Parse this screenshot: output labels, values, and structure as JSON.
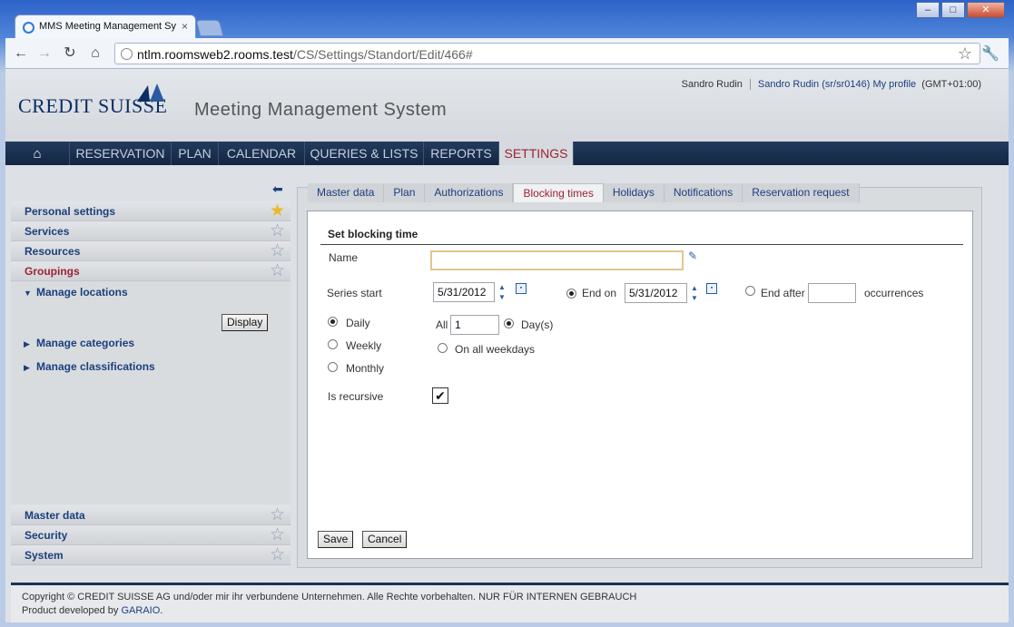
{
  "browser": {
    "tab_title": "MMS Meeting Management Sy",
    "tab_close": "×",
    "url_host": "ntlm.roomsweb2.rooms.test",
    "url_path": "/CS/Settings/Standort/Edit/466#",
    "window_buttons": {
      "minimize": "–",
      "maximize": "□",
      "close": "✕"
    },
    "nav": {
      "back": "←",
      "forward": "→",
      "reload": "↻",
      "home": "⌂"
    },
    "bookmark": "☆",
    "wrench": "🔧"
  },
  "header": {
    "logo_text": "CREDIT SUISSE",
    "app_title": "Meeting Management System",
    "user_name": "Sandro Rudin",
    "user_link": "Sandro Rudin (sr/sr0146) My profile",
    "timezone": "(GMT+01:00)"
  },
  "menu": {
    "home": "⌂",
    "items": [
      {
        "label": "RESERVATION"
      },
      {
        "label": "PLAN"
      },
      {
        "label": "CALENDAR"
      },
      {
        "label": "QUERIES & LISTS"
      },
      {
        "label": "REPORTS"
      },
      {
        "label": "SETTINGS",
        "active": true
      }
    ]
  },
  "sidebar": {
    "back_icon": "⬅",
    "sections_top": [
      {
        "label": "Personal settings",
        "starred": true
      },
      {
        "label": "Services"
      },
      {
        "label": "Resources"
      },
      {
        "label": "Groupings",
        "active": true
      }
    ],
    "manage_locations": "Manage locations",
    "display_button": "Display",
    "manage_categories": "Manage categories",
    "manage_classifications": "Manage classifications",
    "sections_bottom": [
      {
        "label": "Master data"
      },
      {
        "label": "Security"
      },
      {
        "label": "System"
      }
    ],
    "star_empty": "☆",
    "star_filled": "★"
  },
  "subtabs": [
    {
      "label": "Master data"
    },
    {
      "label": "Plan"
    },
    {
      "label": "Authorizations"
    },
    {
      "label": "Blocking times",
      "active": true
    },
    {
      "label": "Holidays"
    },
    {
      "label": "Notifications"
    },
    {
      "label": "Reservation request"
    }
  ],
  "form": {
    "title": "Set blocking time",
    "name_label": "Name",
    "name_value": "",
    "series_start_label": "Series start",
    "series_start_value": "5/31/2012",
    "end_on_label": "End on",
    "end_on_value": "5/31/2012",
    "end_on_selected": true,
    "end_after_label": "End after",
    "end_after_value": "",
    "occurrences_label": "occurrences",
    "recurrence": [
      {
        "label": "Daily",
        "selected": true
      },
      {
        "label": "Weekly",
        "selected": false
      },
      {
        "label": "Monthly",
        "selected": false
      }
    ],
    "all_label": "All",
    "all_value": "1",
    "days_label": "Day(s)",
    "days_selected": true,
    "weekdays_label": "On all weekdays",
    "weekdays_selected": false,
    "is_recursive_label": "Is recursive",
    "is_recursive_checked": true,
    "check_mark": "✔",
    "save_button": "Save",
    "cancel_button": "Cancel"
  },
  "footer": {
    "copyright": "Copyright © CREDIT SUISSE AG und/oder mir ihr verbundene Unternehmen. Alle Rechte vorbehalten. NUR FÜR INTERNEN GEBRAUCH",
    "product_prefix": "Product developed by",
    "product_vendor": "GARAIO",
    "product_suffix": "."
  }
}
